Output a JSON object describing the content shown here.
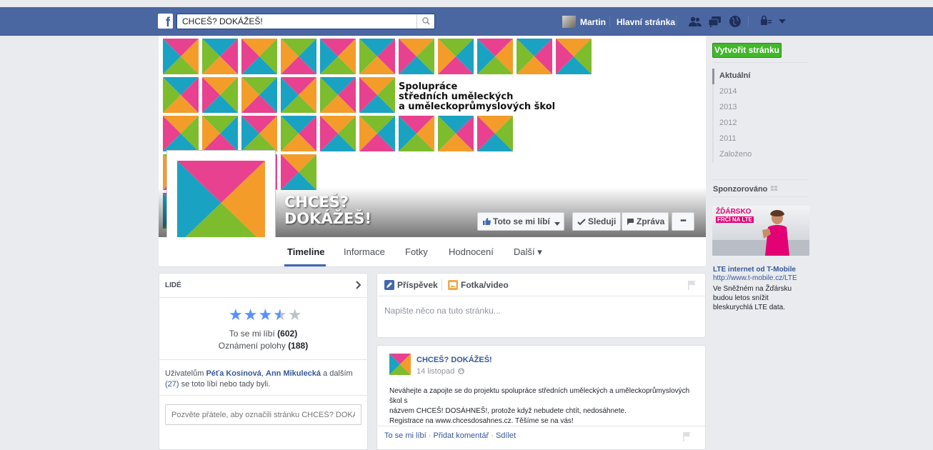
{
  "topbar": {
    "search_value": "CHCEŠ? DOKÁŽEŠ!",
    "user_name": "Martin",
    "home_label": "Hlavní stránka"
  },
  "cover": {
    "caption_line1": "Spolupráce",
    "caption_line2": "středních uměleckých",
    "caption_line3": "a uměleckoprůmyslových škol",
    "page_name": "CHCEŠ? DOKÁŽEŠ!",
    "like_button": "Toto se mi líbí",
    "follow_button": "Sleduji",
    "message_button": "Zpráva",
    "more_button": "•••"
  },
  "tabs": {
    "timeline": "Timeline",
    "about": "Informace",
    "photos": "Fotky",
    "reviews": "Hodnocení",
    "more": "Další ▾"
  },
  "right_column": {
    "create_page": "Vytvořit stránku",
    "timeline_nav": [
      "Aktuální",
      "2014",
      "2013",
      "2012",
      "2011",
      "Založeno"
    ],
    "sponsored_label": "Sponzorováno",
    "ad_image_line1": "ŽĎÁRSKO",
    "ad_image_line2": "FRČÍ NA LTE",
    "ad_title": "LTE internet od T-Mobile",
    "ad_url": "http://www.t-mobile.cz/LTE",
    "ad_text": "Ve Sněžném na Žďársku budou letos snížit bleskurychlá LTE data."
  },
  "people": {
    "header": "LIDÉ",
    "stars_filled": "★★★",
    "stars_half": "★",
    "stars_empty": "★",
    "likes_label": "To se mi líbí",
    "likes_count": "(602)",
    "checkins_label": "Oznámení polohy",
    "checkins_count": "(188)",
    "friends_prefix": "Uživatelům",
    "friend1": "Péťa Kosinová",
    "friend_sep": ",",
    "friend2": "Ann Mikulecká",
    "friends_middle": "a dalším",
    "friends_count": "(27)",
    "friends_suffix": "se toto líbí nebo tady byli.",
    "invite_placeholder": "Pozvěte přátele, aby označili stránku CHCEŠ? DOKÁ..."
  },
  "composer": {
    "post_tab": "Příspěvek",
    "photo_tab": "Fotka/video",
    "placeholder": "Napište něco na tuto stránku..."
  },
  "post": {
    "author": "CHCEŠ? DOKÁŽEŠ!",
    "date": "14 listopad",
    "line1": "Neváhejte a zapojte se do projektu spolupráce středních uměleckých a uměleckoprůmyslových škol s",
    "line2": "názvem CHCEŠ! DOSÁHNEŠ!, protože když nebudete chtít, nedosáhnete.",
    "line3": "Registrace na www.chcesdosahnes.cz. Těšíme se na vás!",
    "like": "To se mi líbí",
    "comment": "Přidat komentář",
    "share": "Sdílet",
    "action_sep": "·"
  },
  "colors": {
    "pink": "#e8418f",
    "teal": "#1aa2c2",
    "orange": "#f39c2a",
    "green": "#7cbc2d",
    "facebook_blue": "#4b67a1"
  }
}
